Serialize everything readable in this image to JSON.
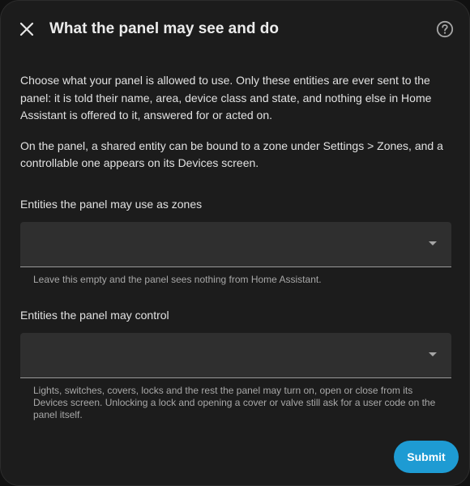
{
  "dialog": {
    "title": "What the panel may see and do",
    "close_icon": "close-icon",
    "help_icon": "help-circle-icon"
  },
  "intro": {
    "paragraph_1": "Choose what your panel is allowed to use. Only these entities are ever sent to the panel: it is told their name, area, device class and state, and nothing else in Home Assistant is offered to it, answered for or acted on.",
    "paragraph_2": "On the panel, a shared entity can be bound to a zone under Settings > Zones, and a controllable one appears on its Devices screen."
  },
  "zones_field": {
    "label": "Entities the panel may use as zones",
    "value": "",
    "helper": "Leave this empty and the panel sees nothing from Home Assistant."
  },
  "control_field": {
    "label": "Entities the panel may control",
    "value": "",
    "helper": "Lights, switches, covers, locks and the rest the panel may turn on, open or close from its Devices screen. Unlocking a lock and opening a cover or valve still ask for a user code on the panel itself."
  },
  "actions": {
    "submit_label": "Submit"
  },
  "colors": {
    "dialog_background": "#1c1c1c",
    "field_background": "#2f2f2f",
    "primary_button": "#1e9bd3",
    "helper_text": "#a8a8a8"
  }
}
